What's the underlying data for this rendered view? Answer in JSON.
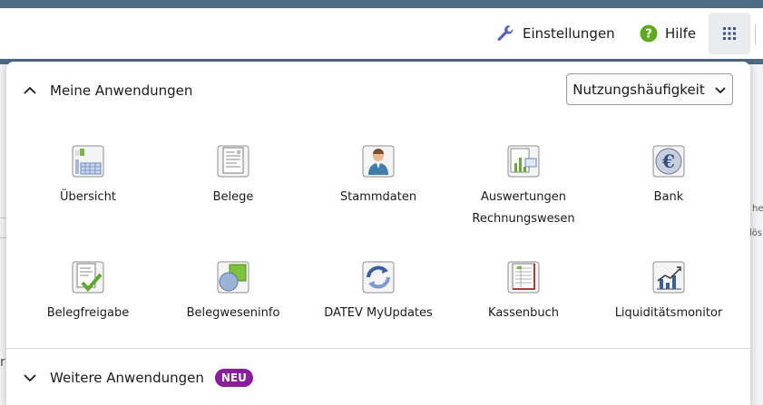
{
  "header": {
    "settings_label": "Einstellungen",
    "help_label": "Hilfe",
    "accent": "#4e6b84"
  },
  "background": {
    "text_right_1": "he",
    "text_right_2": "lös",
    "text_left": "r"
  },
  "panel": {
    "my_apps_title": "Meine Anwendungen",
    "sort_label": "Nutzungshäufigkeit",
    "more_apps_title": "Weitere Anwendungen",
    "new_badge": "NEU",
    "badge_color": "#8a1d9b",
    "apps": [
      {
        "label": "Übersicht",
        "icon": "overview-icon"
      },
      {
        "label": "Belege",
        "icon": "receipts-icon"
      },
      {
        "label": "Stammdaten",
        "icon": "person-icon"
      },
      {
        "label": "Auswertungen Rechnungswesen",
        "icon": "reports-icon"
      },
      {
        "label": "Bank",
        "icon": "euro-icon"
      },
      {
        "label": "Belegfreigabe",
        "icon": "receipt-approval-icon"
      },
      {
        "label": "Belegweseninfo",
        "icon": "receipt-info-icon"
      },
      {
        "label": "DATEV MyUpdates",
        "icon": "updates-icon"
      },
      {
        "label": "Kassenbuch",
        "icon": "cashbook-icon"
      },
      {
        "label": "Liquiditätsmonitor",
        "icon": "liquidity-chart-icon"
      }
    ]
  }
}
